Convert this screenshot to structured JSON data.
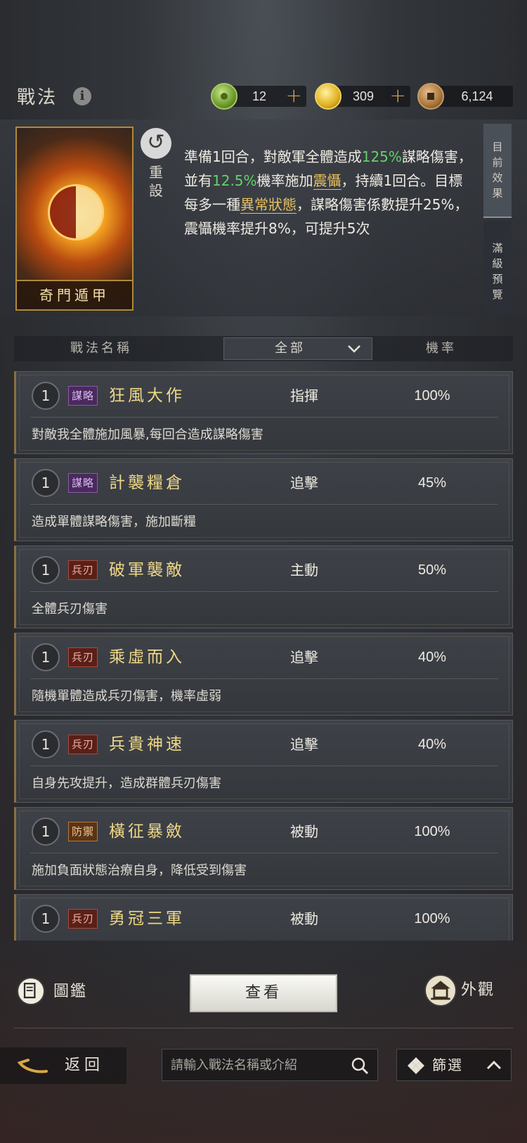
{
  "header": {
    "title": "戰法",
    "resources": [
      {
        "name": "jade",
        "value": "12"
      },
      {
        "name": "gold",
        "value": "309"
      },
      {
        "name": "copper",
        "value": "6,124"
      }
    ],
    "plus": "+"
  },
  "detail": {
    "card_name": "奇門遁甲",
    "reset_label_1": "重",
    "reset_label_2": "設",
    "desc": {
      "p1": "準備1回合，對敵軍全體造成",
      "h1": "125%",
      "p2": "謀略傷害，並有",
      "h2": "12.5%",
      "p3": "機率施加",
      "h3": "震懾",
      "p4": "，持續1回合。目標每多一種",
      "h4": "異常狀態",
      "p5": "，謀略傷害係數提升25%，震懾機率提升8%，可提升5次"
    },
    "tabs": [
      {
        "l1": "目",
        "l2": "前",
        "l3": "效",
        "l4": "果"
      },
      {
        "l1": "滿",
        "l2": "級",
        "l3": "預",
        "l4": "覽"
      }
    ]
  },
  "columns": {
    "name": "戰法名稱",
    "filter": "全部",
    "rate": "機率"
  },
  "skills": [
    {
      "level": "1",
      "tag": "謀略",
      "name": "狂風大作",
      "type": "指揮",
      "rate": "100%",
      "desc": "對敵我全體施加風暴,每回合造成謀略傷害"
    },
    {
      "level": "1",
      "tag": "謀略",
      "name": "計襲糧倉",
      "type": "追擊",
      "rate": "45%",
      "desc": "造成單體謀略傷害，施加斷糧"
    },
    {
      "level": "1",
      "tag": "兵刃",
      "name": "破軍襲敵",
      "type": "主動",
      "rate": "50%",
      "desc": "全體兵刃傷害"
    },
    {
      "level": "1",
      "tag": "兵刃",
      "name": "乘虛而入",
      "type": "追擊",
      "rate": "40%",
      "desc": "隨機單體造成兵刃傷害，機率虛弱"
    },
    {
      "level": "1",
      "tag": "兵刃",
      "name": "兵貴神速",
      "type": "追擊",
      "rate": "40%",
      "desc": "自身先攻提升，造成群體兵刃傷害"
    },
    {
      "level": "1",
      "tag": "防禦",
      "name": "橫征暴斂",
      "type": "被動",
      "rate": "100%",
      "desc": "施加負面狀態治療自身，降低受到傷害"
    },
    {
      "level": "1",
      "tag": "兵刃",
      "name": "勇冠三軍",
      "type": "被動",
      "rate": "100%",
      "desc": ""
    }
  ],
  "bottom": {
    "tujian": "圖鑑",
    "view": "查看",
    "waiguan": "外觀",
    "back": "返回",
    "search_placeholder": "請輸入戰法名稱或介紹",
    "filter": "篩選"
  }
}
